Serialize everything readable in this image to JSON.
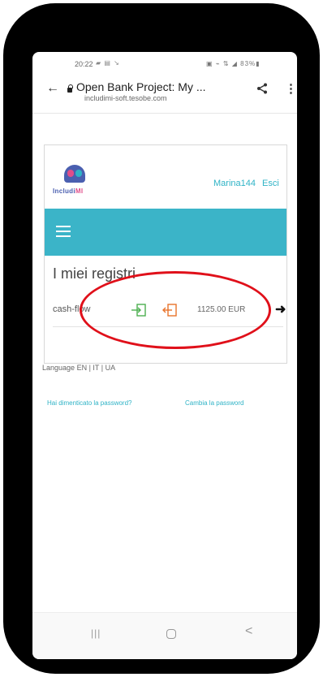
{
  "status_bar": {
    "time": "20:22",
    "left_icons": "▰ ▤ ↘",
    "right_icons": "▣ ⌁ ⇅ ◢ 83%▮"
  },
  "browser": {
    "title": "Open Bank Project: My ...",
    "url": "includimi-soft.tesobe.com",
    "back_glyph": "←",
    "menu_glyph": "⋮"
  },
  "app": {
    "logo_text_main": "Includi",
    "logo_text_accent": "MI",
    "username": "Marina144",
    "logout_label": "Esci",
    "section_title": "I miei registri",
    "registri": [
      {
        "name": "cash-flow",
        "amount": "1125.00 EUR"
      }
    ],
    "arrow_glyph": "➜",
    "language_label": "Language",
    "languages": [
      "EN",
      "IT",
      "UA"
    ],
    "forgot_password": "Hai dimenticato la password?",
    "change_password": "Cambia la password"
  },
  "android_nav": {
    "recent_glyph": "|||",
    "back_glyph": "<"
  },
  "colors": {
    "accent": "#3bb4c8",
    "link": "#2fb3c6",
    "annotation": "#e0101a",
    "in_icon": "#4caf50",
    "out_icon": "#e8732a"
  },
  "icons": [
    "back-icon",
    "lock-icon",
    "share-icon",
    "menu-icon",
    "hamburger-icon",
    "login-icon",
    "logout-icon",
    "arrow-right-icon",
    "recent-apps-icon",
    "home-icon",
    "nav-back-icon"
  ]
}
